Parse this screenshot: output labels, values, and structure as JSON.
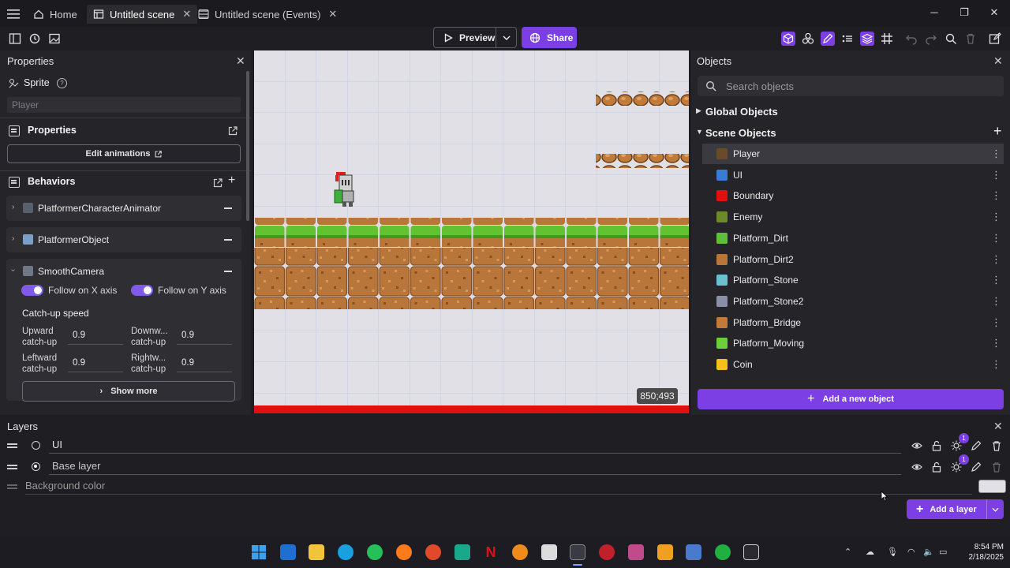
{
  "titlebar": {
    "tabs": [
      {
        "label": "Home"
      },
      {
        "label": "Untitled scene"
      },
      {
        "label": "Untitled scene (Events)"
      }
    ]
  },
  "toolbar": {
    "preview_label": "Preview",
    "share_label": "Share"
  },
  "properties": {
    "title": "Properties",
    "object_type": "Sprite",
    "object_name_placeholder": "Player",
    "properties_section": "Properties",
    "edit_animations": "Edit animations",
    "behaviors_section": "Behaviors",
    "behaviors": [
      {
        "label": "PlatformerCharacterAnimator"
      },
      {
        "label": "PlatformerObject"
      },
      {
        "label": "SmoothCamera"
      }
    ],
    "follow_x": "Follow on X axis",
    "follow_y": "Follow on Y axis",
    "catchup_title": "Catch-up speed",
    "upward_label": "Upward catch-up",
    "upward_value": "0.9",
    "downward_label": "Downw... catch-up",
    "downward_value": "0.9",
    "leftward_label": "Leftward catch-up",
    "leftward_value": "0.9",
    "rightward_label": "Rightw... catch-up",
    "rightward_value": "0.9",
    "show_more": "Show more"
  },
  "scene": {
    "coords": "850;493"
  },
  "objects": {
    "title": "Objects",
    "search_placeholder": "Search objects",
    "global_group": "Global Objects",
    "scene_group": "Scene Objects",
    "items": [
      {
        "label": "Player",
        "color": "#6b4a2a"
      },
      {
        "label": "UI",
        "color": "#3a7bd5"
      },
      {
        "label": "Boundary",
        "color": "#e01010"
      },
      {
        "label": "Enemy",
        "color": "#6b8a2a"
      },
      {
        "label": "Platform_Dirt",
        "color": "#5fbf3a"
      },
      {
        "label": "Platform_Dirt2",
        "color": "#b8763a"
      },
      {
        "label": "Platform_Stone",
        "color": "#6ac0d0"
      },
      {
        "label": "Platform_Stone2",
        "color": "#8a8fa8"
      },
      {
        "label": "Platform_Bridge",
        "color": "#c07a3a"
      },
      {
        "label": "Platform_Moving",
        "color": "#6ccf3a"
      },
      {
        "label": "Coin",
        "color": "#f2c21a"
      }
    ],
    "add_label": "Add a new object"
  },
  "layers": {
    "title": "Layers",
    "rows": [
      {
        "name": "UI"
      },
      {
        "name": "Base layer"
      }
    ],
    "badge": "1",
    "background_label": "Background color",
    "add_label": "Add a layer"
  },
  "taskbar": {
    "time": "8:54 PM",
    "date": "2/18/2025"
  },
  "colors": {
    "accent": "#7b3fe4",
    "panel": "#252529",
    "scene_bg": "#e0e0e6",
    "grass": "#63c232",
    "dirt": "#b8763a",
    "boundary": "#e01010"
  }
}
